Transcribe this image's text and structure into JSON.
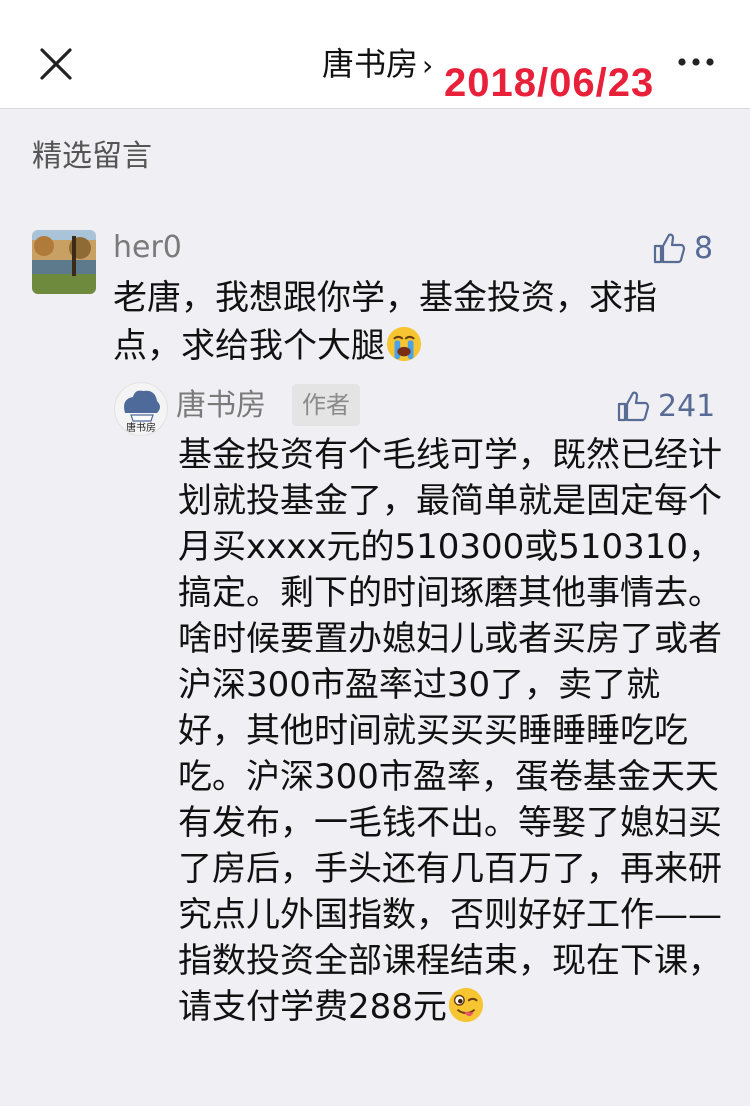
{
  "navbar": {
    "title": "唐书房",
    "title_chevron": "›",
    "close_icon": "close-icon",
    "more_icon": "more-dots-icon"
  },
  "date_stamp": "2018/06/23",
  "section_title": "精选留言",
  "comment": {
    "nickname": "her0",
    "likes": "8",
    "text": "老唐，我想跟你学，基金投资，求指点，求给我个大腿",
    "emoji": "crying-face-emoji"
  },
  "reply": {
    "author": "唐书房",
    "avatar_caption": "唐书房",
    "badge": "作者",
    "likes": "241",
    "text": "基金投资有个毛线可学，既然已经计划就投基金了，最简单就是固定每个月买xxxx元的510300或510310，搞定。剩下的时间琢磨其他事情去。啥时候要置办媳妇儿或者买房了或者沪深300市盈率过30了，卖了就好，其他时间就买买买睡睡睡吃吃吃。沪深300市盈率，蛋卷基金天天有发布，一毛钱不出。等娶了媳妇买了房后，手头还有几百万了，再来研究点儿外国指数，否则好好工作——指数投资全部课程结束，现在下课，请支付学费288元",
    "emoji": "winking-tongue-face-emoji"
  },
  "colors": {
    "accent": "#576b95",
    "date_stamp": "#e8203a",
    "background": "#efeff4"
  }
}
